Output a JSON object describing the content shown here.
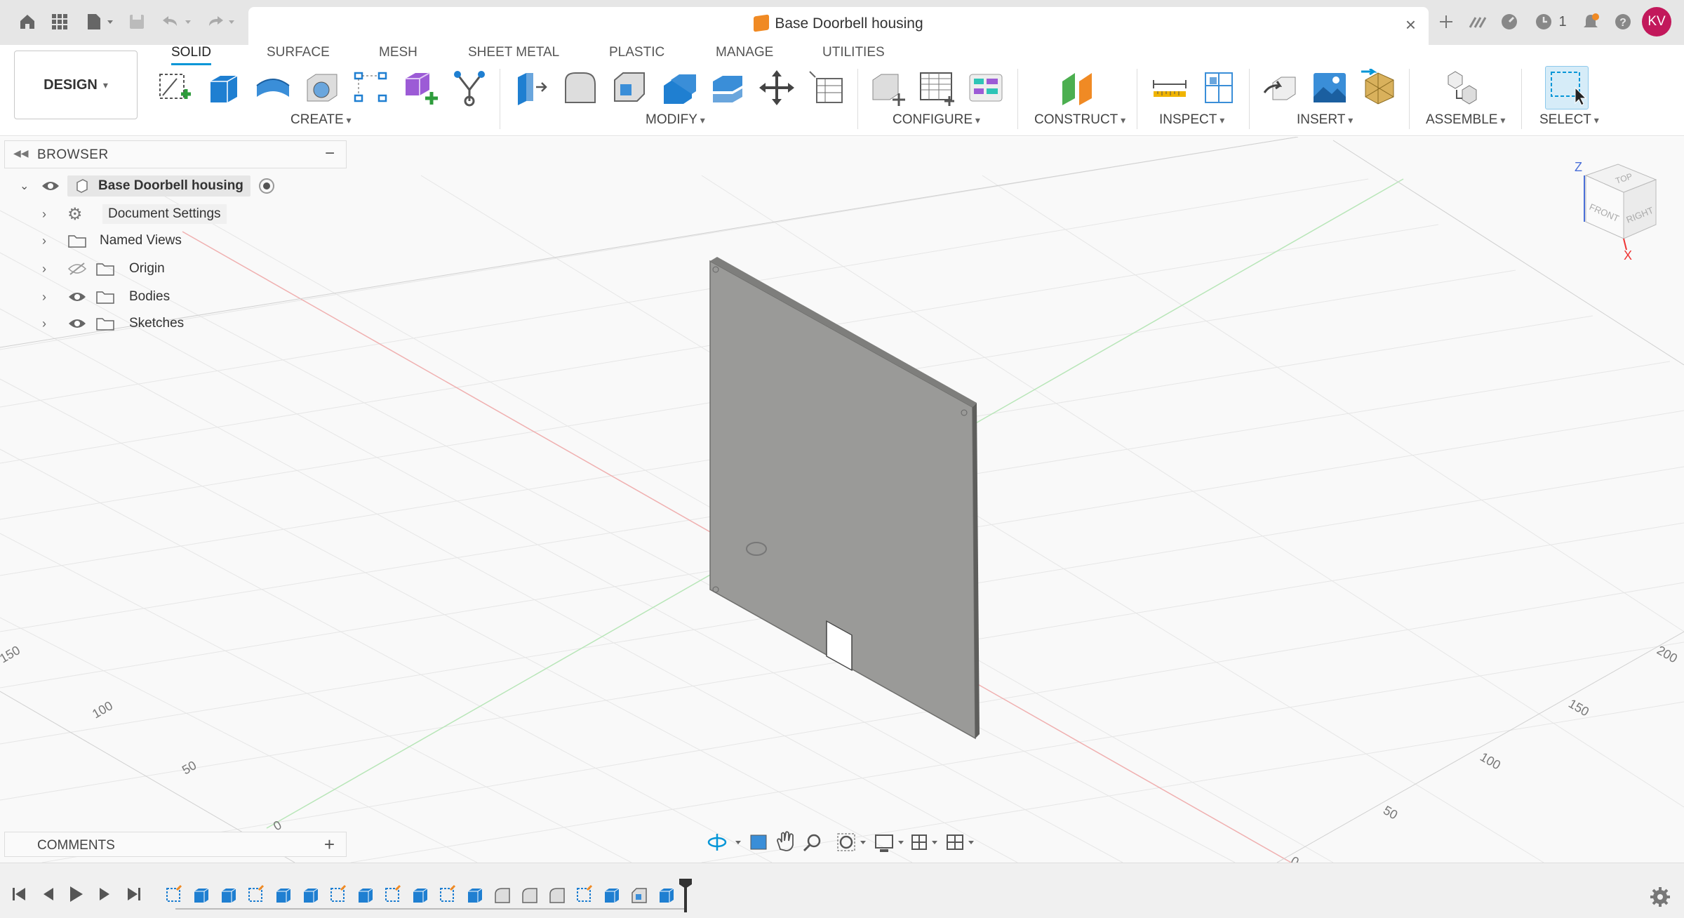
{
  "window": {
    "title": "Base Doorbell housing",
    "close": "×",
    "job_count": "1",
    "user_initials": "KV"
  },
  "toolbar": {
    "design_label": "DESIGN",
    "tabs": [
      "SOLID",
      "SURFACE",
      "MESH",
      "SHEET METAL",
      "PLASTIC",
      "MANAGE",
      "UTILITIES"
    ],
    "groups": [
      "CREATE",
      "MODIFY",
      "CONFIGURE",
      "CONSTRUCT",
      "INSPECT",
      "INSERT",
      "ASSEMBLE",
      "SELECT"
    ]
  },
  "browser": {
    "title": "BROWSER",
    "collapse": "−",
    "root": "Base Doorbell housing",
    "items": [
      "Document Settings",
      "Named Views",
      "Origin",
      "Bodies",
      "Sketches"
    ]
  },
  "comments": {
    "title": "COMMENTS",
    "add": "+"
  },
  "axes": {
    "left": [
      "150",
      "100",
      "50",
      "0"
    ],
    "right": [
      "200",
      "150",
      "100",
      "50",
      "0"
    ]
  },
  "viewcube": {
    "top": "TOP",
    "front": "FRONT",
    "right": "RIGHT",
    "z": "Z",
    "x": "X"
  },
  "colors": {
    "accent": "#0696d7",
    "body": "#9a9a98",
    "user": "#c2185b"
  }
}
